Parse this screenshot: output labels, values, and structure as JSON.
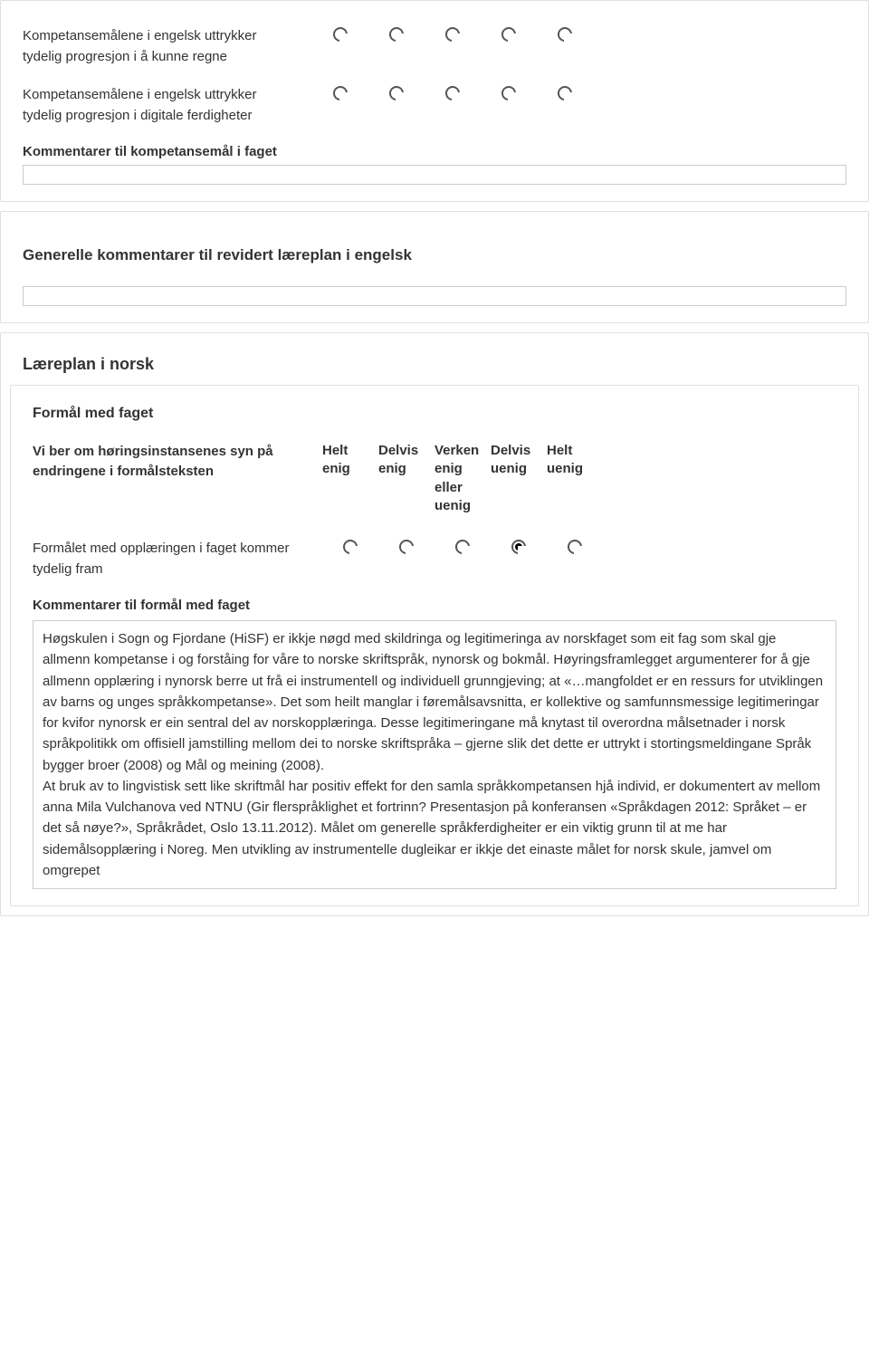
{
  "panel1": {
    "rows": [
      {
        "label": "Kompetansemålene i engelsk uttrykker tydelig progresjon i å kunne regne"
      },
      {
        "label": "Kompetansemålene i engelsk uttrykker tydelig progresjon i digitale ferdigheter"
      }
    ],
    "comment_label": "Kommentarer til kompetansemål i faget"
  },
  "panel2": {
    "title": "Generelle kommentarer til revidert læreplan i engelsk"
  },
  "panel3": {
    "outer_title": "Læreplan i norsk",
    "subtitle": "Formål med faget",
    "header_question": "Vi ber om høringsinstansenes syn på endringene i formålsteksten",
    "header_options": [
      "Helt enig",
      "Delvis enig",
      "Verken enig eller uenig",
      "Delvis uenig",
      "Helt uenig"
    ],
    "row": {
      "label": "Formålet med opplæringen i faget kommer tydelig fram",
      "selected": 3
    },
    "comment_label": "Kommentarer til formål med faget",
    "comment_text": "Høgskulen i Sogn og Fjordane (HiSF) er ikkje nøgd med skildringa og legitimeringa av norskfaget som eit fag som skal gje allmenn kompetanse i og forståing for våre to norske skriftspråk, nynorsk og bokmål. Høyringsframlegget argumenterer for å gje allmenn opplæring i nynorsk berre ut frå ei instrumentell og individuell grunngjeving; at «…mangfoldet er en ressurs for utviklingen av barns og unges språkkompetanse». Det som heilt manglar i føremålsavsnitta, er kollektive og samfunnsmessige legitimeringar for kvifor nynorsk er ein sentral del av norskopplæringa. Desse legitimeringane må knytast til overordna målsetnader i norsk språkpolitikk om offisiell jamstilling mellom dei to norske skriftspråka – gjerne slik det dette er uttrykt i stortingsmeldingane Språk bygger broer (2008) og Mål og meining (2008).\nAt bruk av to lingvistisk sett like skriftmål har positiv effekt for den samla språkkompetansen hjå individ, er dokumentert av mellom anna Mila Vulchanova ved NTNU (Gir flerspråklighet et fortrinn? Presentasjon på konferansen «Språkdagen 2012: Språket – er det så nøye?», Språkrådet, Oslo 13.11.2012). Målet om generelle språkferdigheiter er ein viktig grunn til at me har sidemålsopplæring i Noreg. Men utvikling av instrumentelle dugleikar er ikkje det einaste målet for norsk skule, jamvel om omgrepet"
  }
}
